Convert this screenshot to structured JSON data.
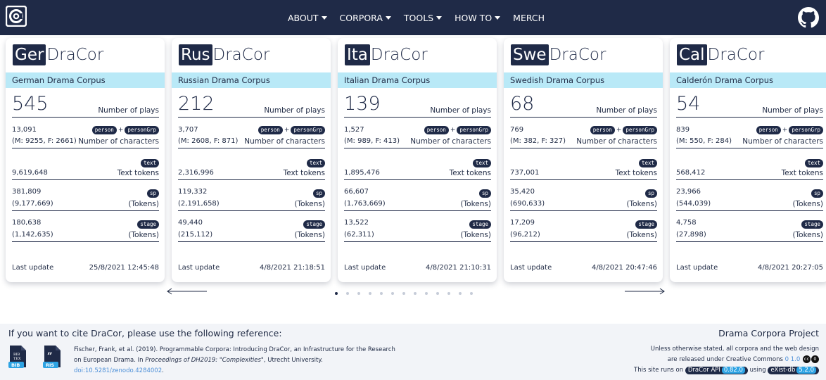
{
  "nav": {
    "about": "ABOUT",
    "corpora": "CORPORA",
    "tools": "TOOLS",
    "howto": "HOW TO",
    "merch": "MERCH"
  },
  "labels": {
    "plays": "Number of plays",
    "characters": "Number of characters",
    "person": "person",
    "plus": "+",
    "personGrp": "personGrp",
    "text": "text",
    "textTokens": "Text tokens",
    "sp": "sp",
    "tokens": "(Tokens)",
    "stage": "stage",
    "lastUpdate": "Last update"
  },
  "cards": [
    {
      "prefix": "Ger",
      "suffix": "DraCor",
      "subtitle": "German Drama Corpus",
      "plays": "545",
      "characters": "13,091",
      "chars_mf": "(M: 9255, F: 2661)",
      "text_tokens": "9,619,648",
      "sp": "381,809",
      "sp_tokens": "(9,177,669)",
      "stage": "180,638",
      "stage_tokens": "(1,142,635)",
      "updated": "25/8/2021 12:45:48"
    },
    {
      "prefix": "Rus",
      "suffix": "DraCor",
      "subtitle": "Russian Drama Corpus",
      "plays": "212",
      "characters": "3,707",
      "chars_mf": "(M: 2608, F: 871)",
      "text_tokens": "2,316,996",
      "sp": "119,332",
      "sp_tokens": "(2,191,658)",
      "stage": "49,440",
      "stage_tokens": "(215,112)",
      "updated": "4/8/2021 21:18:51"
    },
    {
      "prefix": "Ita",
      "suffix": "DraCor",
      "subtitle": "Italian Drama Corpus",
      "plays": "139",
      "characters": "1,527",
      "chars_mf": "(M: 989, F: 413)",
      "text_tokens": "1,895,476",
      "sp": "66,607",
      "sp_tokens": "(1,763,669)",
      "stage": "13,522",
      "stage_tokens": "(62,311)",
      "updated": "4/8/2021 21:10:31"
    },
    {
      "prefix": "Swe",
      "suffix": "DraCor",
      "subtitle": "Swedish Drama Corpus",
      "plays": "68",
      "characters": "769",
      "chars_mf": "(M: 382, F: 327)",
      "text_tokens": "737,001",
      "sp": "35,420",
      "sp_tokens": "(690,633)",
      "stage": "17,209",
      "stage_tokens": "(96,212)",
      "updated": "4/8/2021 20:47:46"
    },
    {
      "prefix": "Cal",
      "suffix": "DraCor",
      "subtitle": "Calderón Drama Corpus",
      "plays": "54",
      "characters": "839",
      "chars_mf": "(M: 550, F: 284)",
      "text_tokens": "568,412",
      "sp": "23,966",
      "sp_tokens": "(544,039)",
      "stage": "4,758",
      "stage_tokens": "(27,898)",
      "updated": "4/8/2021 20:27:05"
    }
  ],
  "carousel": {
    "dot_count": 13,
    "active_index": 0
  },
  "footer": {
    "cite_heading": "If you want to cite DraCor, please use the following reference:",
    "bib_label": "BIB",
    "ris_label": "RIS",
    "cite_part1": "Fischer, Frank, et al. (2019). Programmable Corpora: Introducing DraCor, an Infrastructure for the Research on European Drama. In ",
    "cite_italic": "Proceedings of DH2019: \"Complexities\"",
    "cite_part2": ", Utrecht University. ",
    "cite_doi": "doi:10.5281/zenodo.4284002",
    "cite_end": ".",
    "project_heading": "Drama Corpora Project",
    "license_line1": "Unless otherwise stated, all corpora and the web design",
    "license_line2": "are released under Creative Commons ",
    "license_link": "0 1.0",
    "cc_icon": "cc",
    "zero_icon": "0",
    "runs_on": "This site runs on ",
    "api_label": "DraCor API",
    "api_version": "0.82.0",
    "using": " using ",
    "exist_label": "eXist-db",
    "exist_version": "5.2.0"
  },
  "colors": {
    "nav_bg": "#1f2a47",
    "subtitle_bg": "#b9e9f7",
    "link": "#4c8fd8",
    "version_badge": "#2ea3e3"
  }
}
